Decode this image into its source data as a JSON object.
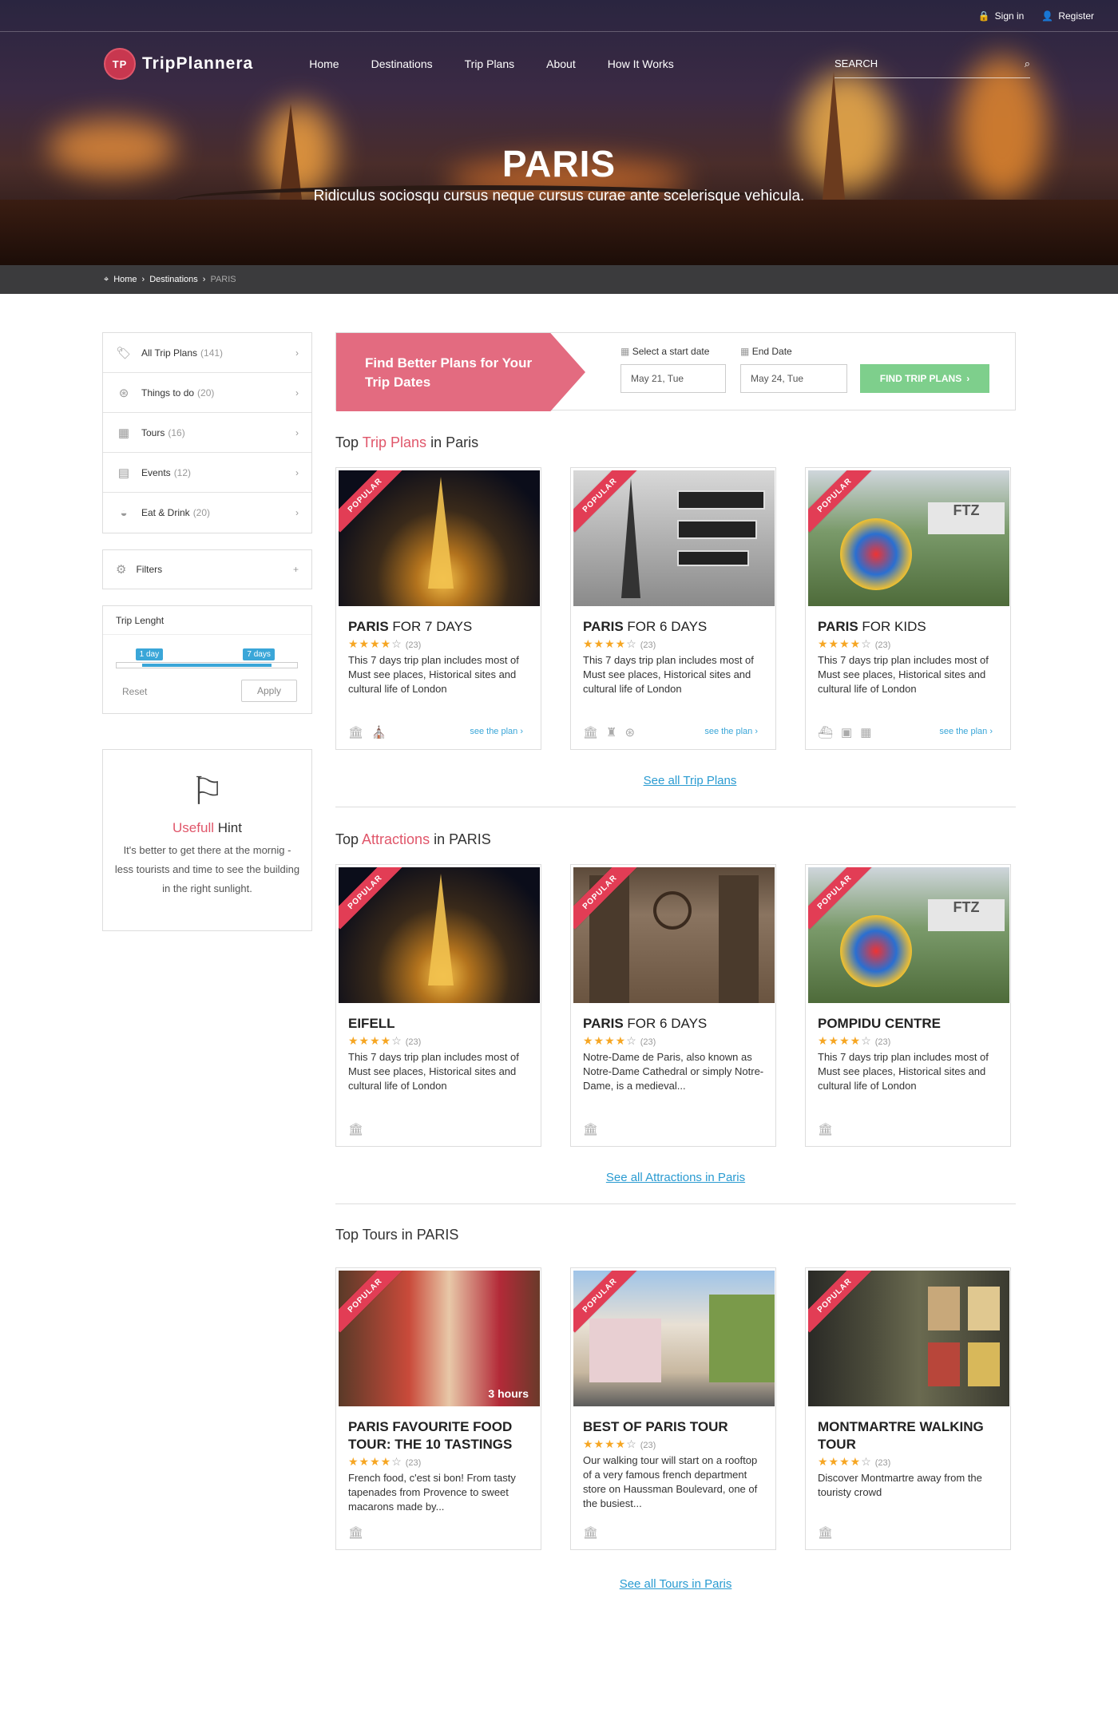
{
  "topbar": {
    "signin": "Sign in",
    "register": "Register"
  },
  "brand": {
    "logo_mark": "TP",
    "name": "TripPlannera"
  },
  "nav": [
    "Home",
    "Destinations",
    "Trip Plans",
    "About",
    "How It Works"
  ],
  "search": {
    "placeholder": "SEARCH"
  },
  "hero": {
    "title": "PARIS",
    "subtitle": "Ridiculus sociosqu cursus neque cursus curae ante scelerisque vehicula."
  },
  "breadcrumb": {
    "home": "Home",
    "destinations": "Destinations",
    "current": "PARIS",
    "sep": "›"
  },
  "sidebar": {
    "categories": [
      {
        "label": "All Trip Plans",
        "count": "(141)",
        "icon": "tag-icon"
      },
      {
        "label": "Things to do",
        "count": "(20)",
        "icon": "compass-icon"
      },
      {
        "label": "Tours",
        "count": "(16)",
        "icon": "building-icon"
      },
      {
        "label": "Events",
        "count": "(12)",
        "icon": "calendar-icon"
      },
      {
        "label": "Eat & Drink",
        "count": "(20)",
        "icon": "dish-icon"
      }
    ],
    "filters": "Filters",
    "filters_toggle": "+",
    "trip_length": {
      "title": "Trip Lenght",
      "min_label": "1 day",
      "max_label": "7 days",
      "range_start": 0.14,
      "range_end": 0.86,
      "reset": "Reset",
      "apply": "Apply"
    },
    "hint": {
      "title_red": "Usefull",
      "title_rest": "Hint",
      "text": "It's better to get there at the mornig - less tourists and time to see the building in the right sunlight."
    }
  },
  "finder": {
    "title": "Find Better Plans for Your Trip Dates",
    "start_label": "Select a start date",
    "start_value": "May 21, Tue",
    "end_label": "End Date",
    "end_value": "May 24, Tue",
    "button": "FIND TRIP PLANS"
  },
  "trip_plans": {
    "heading_pre": "Top ",
    "heading_red": "Trip Plans",
    "heading_post": " in Paris",
    "popular": "POPULAR",
    "items": [
      {
        "title_bold": "PARIS",
        "title_rest": " FOR 7 DAYS",
        "stars": 4,
        "reviews": "(23)",
        "desc": "This 7 days trip plan includes most of Must see places, Historical sites and cultural life of London",
        "link": "see the plan ›"
      },
      {
        "title_bold": "PARIS",
        "title_rest": " FOR 6 DAYS",
        "stars": 4,
        "reviews": "(23)",
        "desc": "This 7 days trip plan includes most of Must see places, Historical sites and cultural life of London",
        "link": "see the plan ›"
      },
      {
        "title_bold": "PARIS",
        "title_rest": " FOR KIDS",
        "stars": 4,
        "reviews": "(23)",
        "desc": "This 7 days trip plan includes most of Must see places, Historical sites and cultural life of London",
        "link": "see the plan ›"
      }
    ],
    "see_all": "See all Trip Plans"
  },
  "attractions": {
    "heading_pre": "Top ",
    "heading_red": "Attractions",
    "heading_post": " in PARIS",
    "items": [
      {
        "title_bold": "EIFELL",
        "title_rest": "",
        "stars": 4,
        "reviews": "(23)",
        "desc": "This 7 days trip plan includes most of Must see places, Historical sites and cultural life of London"
      },
      {
        "title_bold": "PARIS",
        "title_rest": " FOR 6 DAYS",
        "stars": 4,
        "reviews": "(23)",
        "desc": "Notre-Dame de Paris, also known as Notre-Dame Cathedral or simply Notre-Dame, is a medieval..."
      },
      {
        "title_bold": "POMPIDU CENTRE",
        "title_rest": "",
        "stars": 4,
        "reviews": "(23)",
        "desc": "This 7 days trip plan includes most of Must see places, Historical sites and cultural life of London"
      }
    ],
    "see_all": "See all Attractions in Paris"
  },
  "tours": {
    "heading": "Top Tours in PARIS",
    "items": [
      {
        "title": "PARIS FAVOURITE FOOD TOUR: THE 10 TASTINGS",
        "stars": 4,
        "reviews": "(23)",
        "desc": "French food, c'est si bon! From tasty tapenades from Provence to sweet macarons made by...",
        "duration": "3 hours"
      },
      {
        "title": "BEST OF PARIS TOUR",
        "stars": 4,
        "reviews": "(23)",
        "desc": "Our walking tour will start on a rooftop of a very famous french department store on Haussman Boulevard, one of the busiest..."
      },
      {
        "title": "MONTMARTRE WALKING TOUR",
        "stars": 4,
        "reviews": "(23)",
        "desc": "Discover Montmartre away from the touristy crowd"
      }
    ],
    "see_all": "See all Tours in Paris"
  },
  "colors": {
    "accent": "#e0566a",
    "link": "#2a9bd1",
    "button_green": "#7ecf8c",
    "breadcrumb_bg": "#3b3b3d"
  }
}
